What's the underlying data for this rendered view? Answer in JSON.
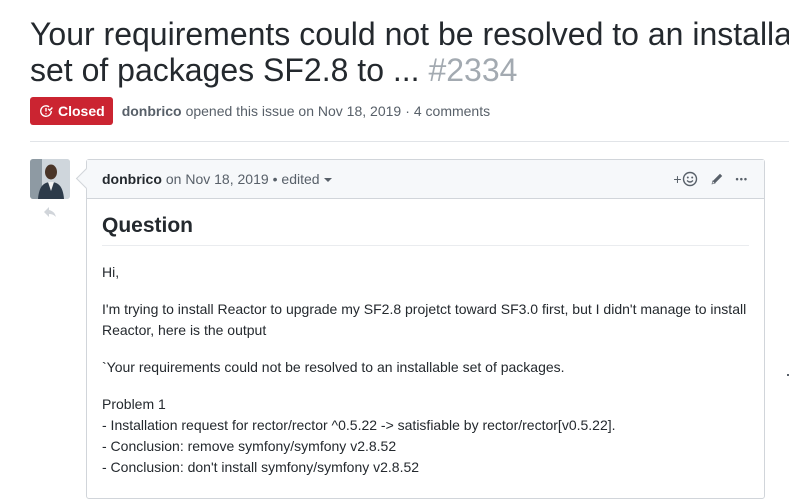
{
  "issue": {
    "title_line1": "Your requirements could not be resolved to an installa",
    "title_line2": "set of packages SF2.8 to ...",
    "number": "#2334",
    "state": "Closed",
    "author": "donbrico",
    "opened_text": "opened this issue on Nov 18, 2019",
    "separator": "·",
    "comments_count": "4 comments"
  },
  "comment": {
    "author": "donbrico",
    "date_text": "on Nov 18, 2019",
    "edited_text": "• edited",
    "reaction_plus": "+",
    "more_label": "•••",
    "heading": "Question",
    "greeting": "Hi,",
    "paragraph1": "I'm trying to install Reactor to upgrade my SF2.8 projetct toward SF3.0 first, but I didn't manage to install Reactor, here is the output",
    "paragraph2": "`Your requirements could not be resolved to an installable set of packages.",
    "problem_title": "Problem 1",
    "lines": [
      "- Installation request for rector/rector ^0.5.22 -> satisfiable by rector/rector[v0.5.22].",
      "- Conclusion: remove symfony/symfony v2.8.52",
      "- Conclusion: don't install symfony/symfony v2.8.52"
    ]
  },
  "colors": {
    "closed_badge": "#cb2431",
    "header_bg": "#f6f8fa",
    "border": "#d1d5da"
  }
}
